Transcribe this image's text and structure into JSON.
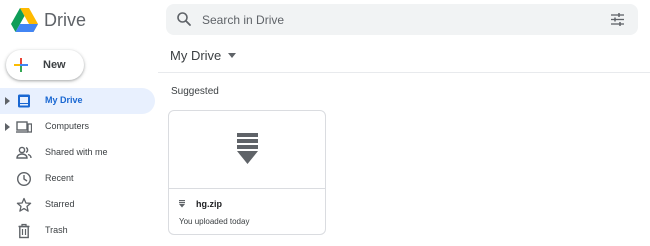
{
  "app": {
    "name": "Drive"
  },
  "search": {
    "placeholder": "Search in Drive"
  },
  "sidebar": {
    "new_label": "New",
    "items": [
      {
        "label": "My Drive",
        "icon": "my-drive-icon",
        "active": true,
        "expandable": true
      },
      {
        "label": "Computers",
        "icon": "computers-icon",
        "active": false,
        "expandable": true
      },
      {
        "label": "Shared with me",
        "icon": "shared-icon",
        "active": false,
        "expandable": false
      },
      {
        "label": "Recent",
        "icon": "clock-icon",
        "active": false,
        "expandable": false
      },
      {
        "label": "Starred",
        "icon": "star-icon",
        "active": false,
        "expandable": false
      },
      {
        "label": "Trash",
        "icon": "trash-icon",
        "active": false,
        "expandable": false
      }
    ]
  },
  "main": {
    "breadcrumb": "My Drive",
    "section_title": "Suggested",
    "files": [
      {
        "name": "hg.zip",
        "subtitle": "You uploaded today",
        "icon": "zip-file-icon"
      }
    ]
  },
  "colors": {
    "accent": "#1967d2",
    "active_bg": "#e8f0fe",
    "search_bg": "#f1f3f4"
  }
}
